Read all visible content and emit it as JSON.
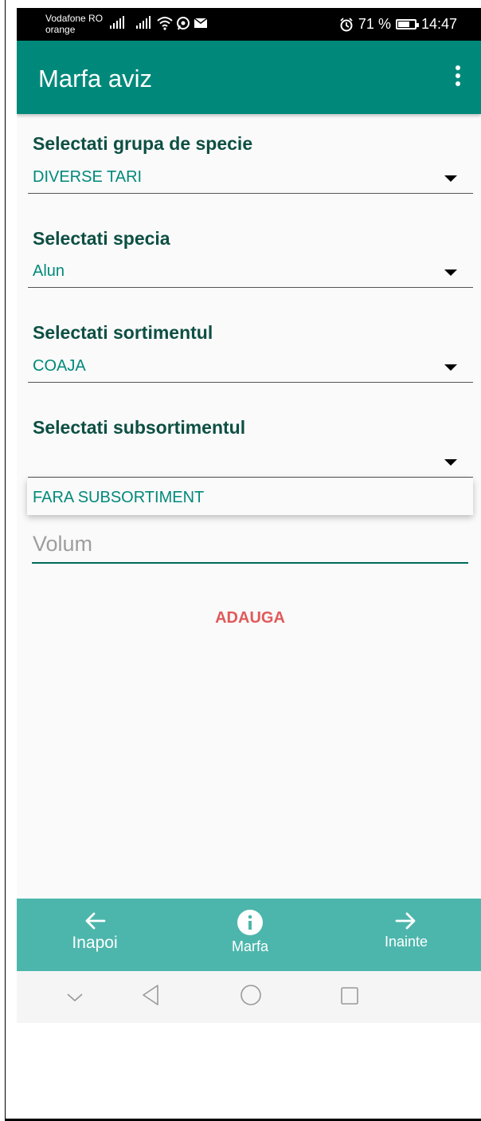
{
  "status_bar": {
    "carrier_line1": "Vodafone RO",
    "carrier_line2": "orange",
    "battery_percent": "71 %",
    "battery_level": 0.71,
    "time": "14:47",
    "icons": [
      "signal-icon",
      "signal-icon",
      "wifi-icon",
      "whatsapp-icon",
      "mail-icon",
      "alarm-icon",
      "battery-icon"
    ]
  },
  "app_bar": {
    "title": "Marfa aviz",
    "menu_icon": "more-vert-icon"
  },
  "form": {
    "group_label": "Selectati grupa de specie",
    "group_value": "DIVERSE TARI",
    "species_label": "Selectati specia",
    "species_value": "Alun",
    "assortment_label": "Selectati sortimentul",
    "assortment_value": "COAJA",
    "subassortment_label": "Selectati subsortimentul",
    "subassortment_value": "",
    "subassortment_options": [
      "FARA SUBSORTIMENT"
    ],
    "volume_placeholder": "Volum",
    "add_label": "ADAUGA"
  },
  "bottom_nav": {
    "back_label": "Inapoi",
    "center_label": "Marfa",
    "next_label": "Inainte"
  },
  "colors": {
    "primary": "#00897b",
    "nav": "#4db6ac",
    "label": "#0d4f43",
    "accent_red": "#e05a5a"
  }
}
